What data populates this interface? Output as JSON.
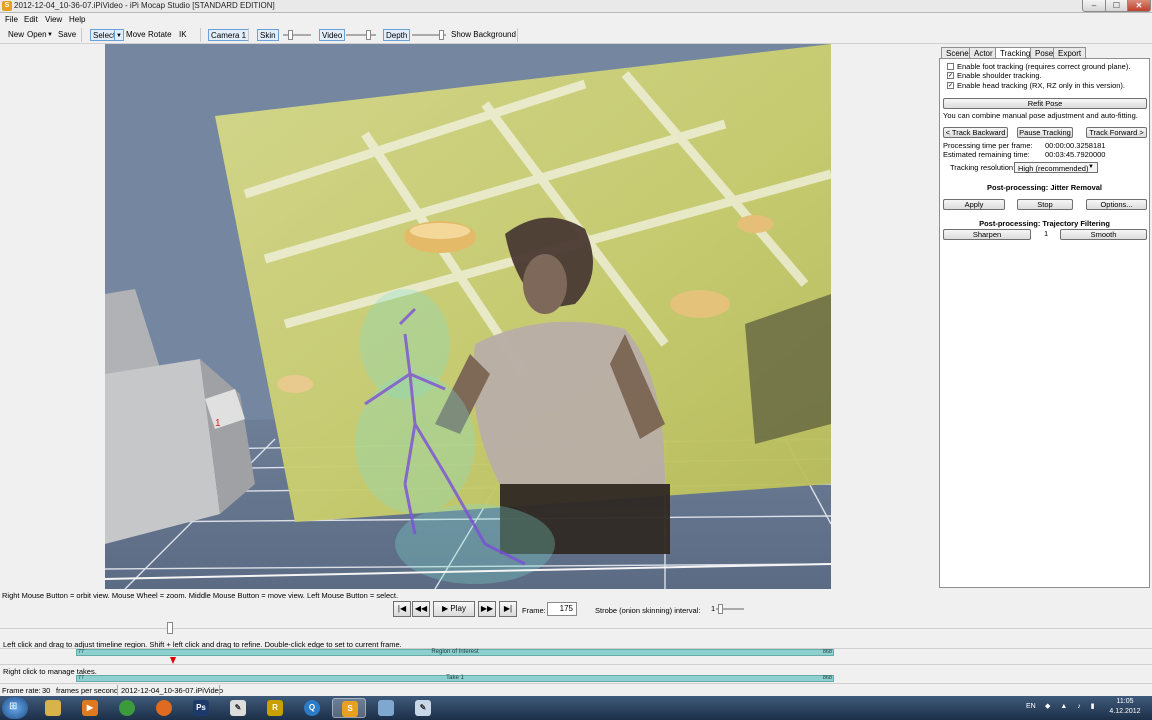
{
  "window": {
    "title": "2012-12-04_10-36-07.iPiVideo - iPi Mocap Studio [STANDARD EDITION]",
    "min": "–",
    "max": "☐",
    "close": "✕"
  },
  "menu": [
    "File",
    "Edit",
    "View",
    "Help"
  ],
  "toolbar": {
    "new": "New",
    "open": "Open",
    "save": "Save",
    "select": "Select",
    "move": "Move",
    "rotate": "Rotate",
    "ik": "IK",
    "camera": "Camera 1",
    "skin": "Skin",
    "video": "Video",
    "depth": "Depth",
    "show_background": "Show Background"
  },
  "viewport": {
    "marker": "1"
  },
  "panel": {
    "tabs": [
      "Scene",
      "Actor",
      "Tracking",
      "Pose",
      "Export"
    ],
    "active_tab": "Tracking",
    "checks": [
      {
        "label": "Enable foot tracking (requires correct ground plane).",
        "checked": false
      },
      {
        "label": "Enable shoulder tracking.",
        "checked": true
      },
      {
        "label": "Enable head tracking (RX, RZ only in this version).",
        "checked": true
      }
    ],
    "check_mark": "✓",
    "refit_pose": "Refit Pose",
    "combine_text": "You can combine manual pose adjustment and auto-fitting.",
    "track_backward": "< Track Backward",
    "pause_tracking": "Pause Tracking",
    "track_forward": "Track Forward >",
    "proc_time_label": "Processing time per frame:",
    "proc_time_value": "00:00:00.3258181",
    "est_time_label": "Estimated remaining time:",
    "est_time_value": "00:03:45.7920000",
    "resolution_label": "Tracking resolution:",
    "resolution_value": "High (recommended)",
    "jitter_title": "Post-processing: Jitter Removal",
    "apply": "Apply",
    "stop": "Stop",
    "options": "Options...",
    "trajectory_title": "Post-processing: Trajectory Filtering",
    "sharpen": "Sharpen",
    "smooth_value": "1",
    "smooth": "Smooth"
  },
  "hint_viewport": "Right Mouse Button = orbit view. Mouse Wheel = zoom. Middle Mouse Button = move view. Left Mouse Button = select.",
  "playback": {
    "play": "Play",
    "frame_label": "Frame:",
    "frame_value": "175",
    "strobe_label": "Strobe (onion skinning) interval:",
    "strobe_value": "1"
  },
  "timeline": {
    "hint": "Left click and drag to adjust timeline region. Shift + left click and drag to refine. Double-click edge to set to current frame.",
    "region_label": "Region of Interest",
    "region_start": "77",
    "region_end": "868",
    "takes_hint": "Right click to manage takes.",
    "take_label": "Take 1",
    "take_start": "77",
    "take_end": "868"
  },
  "status": {
    "frame_rate_label": "Frame rate:",
    "frame_rate_value": "30",
    "fps_label": "frames per second",
    "file": "2012-12-04_10-36-07.iPiVideo"
  },
  "taskbar": {
    "lang": "EN",
    "time": "11:05",
    "date": "4.12.2012"
  }
}
